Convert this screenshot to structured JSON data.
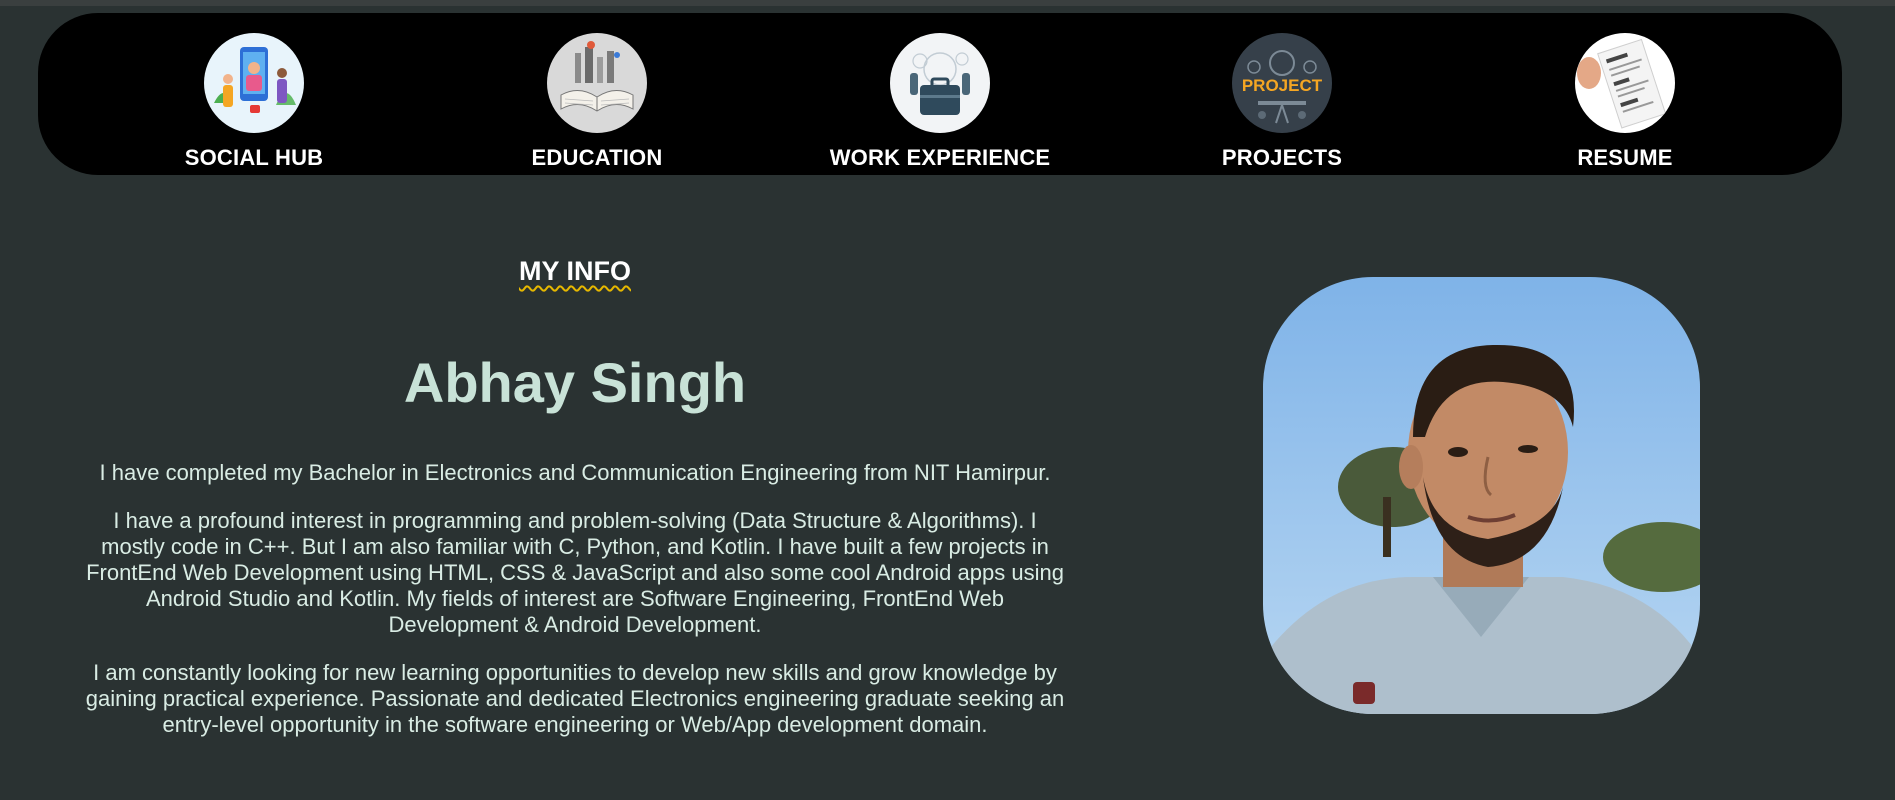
{
  "nav": {
    "items": [
      {
        "label": "SOCIAL HUB",
        "icon": "social-hub-thumbnail"
      },
      {
        "label": "EDUCATION",
        "icon": "education-book-thumbnail"
      },
      {
        "label": "WORK EXPERIENCE",
        "icon": "work-experience-thumbnail"
      },
      {
        "label": "PROJECTS",
        "icon": "projects-thumbnail"
      },
      {
        "label": "RESUME",
        "icon": "resume-thumbnail"
      }
    ]
  },
  "main": {
    "section_title": "MY INFO",
    "name": "Abhay Singh",
    "paragraphs": [
      "I have completed my Bachelor in Electronics and Communication Engineering from NIT Hamirpur.",
      "I have a profound interest in programming and problem-solving (Data Structure & Algorithms). I mostly code in C++. But I am also familiar with C, Python, and Kotlin. I have built a few projects in FrontEnd Web Development using HTML, CSS & JavaScript and also some cool Android apps using Android Studio and Kotlin. My fields of interest are Software Engineering, FrontEnd Web Development & Android Development.",
      "I am constantly looking for new learning opportunities to develop new skills and grow knowledge by gaining practical experience. Passionate and dedicated Electronics engineering graduate seeking an entry-level opportunity in the software engineering or Web/App development domain."
    ]
  },
  "colors": {
    "page_background": "#2a3232",
    "nav_background": "#000000",
    "name_color": "#c8e2d7",
    "text_color": "#d9ece4",
    "underline_accent": "#e6b800"
  }
}
